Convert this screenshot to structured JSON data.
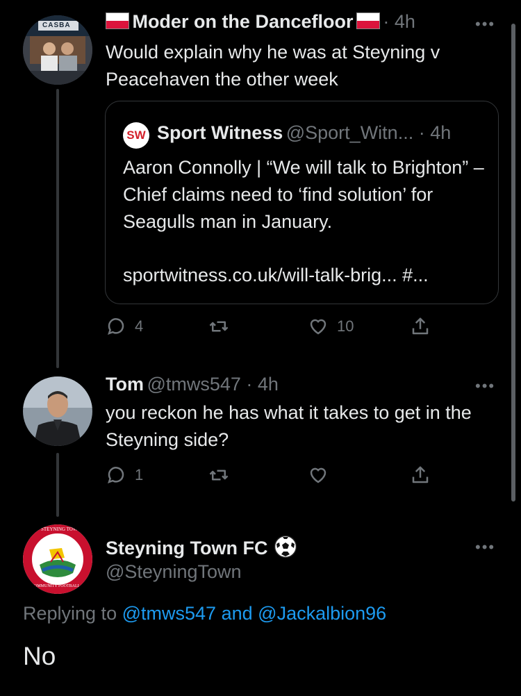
{
  "tweet1": {
    "display_name": "Moder on the Dancefloor",
    "time": "· 4h",
    "text": "Would explain why he was at Steyning v Peacehaven the other week",
    "avatar_sign": "CASBA",
    "quote": {
      "logo": "SW",
      "display_name": "Sport Witness",
      "handle_time": "@Sport_Witn... · 4h",
      "text": "Aaron Connolly | “We will talk to Brighton” – Chief claims need to ‘find solution’ for Seagulls man in January.",
      "link": "sportwitness.co.uk/will-talk-brig... #..."
    },
    "actions": {
      "replies": "4",
      "retweets": "",
      "likes": "10"
    }
  },
  "tweet2": {
    "display_name": "Tom",
    "handle_time": "@tmws547 · 4h",
    "text": "you reckon he has what it takes to get in the Steyning side?",
    "actions": {
      "replies": "1",
      "retweets": "",
      "likes": ""
    }
  },
  "main_tweet": {
    "display_name": "Steyning Town FC",
    "handle": "@SteyningTown",
    "replying_prefix": "Replying to",
    "reply_user1": "@tmws547",
    "reply_and": "and",
    "reply_user2": "@Jackalbion96",
    "text": "No",
    "badge_text_top": "STEYNING TOWN",
    "badge_text_bottom": "COMMUNITY FOOTBALL CLUB"
  },
  "more_glyph": "•••",
  "colors": {
    "background": "#000000",
    "text": "#e7e9ea",
    "muted": "#71767b",
    "link": "#1d9bf0",
    "badge_red": "#c8102e"
  }
}
